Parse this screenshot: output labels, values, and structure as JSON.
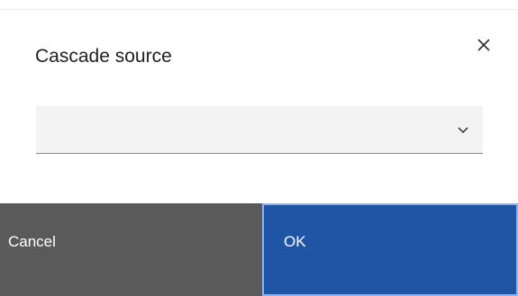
{
  "dialog": {
    "title": "Cascade source",
    "close_icon": "close-icon"
  },
  "select": {
    "value": "",
    "chevron_icon": "chevron-down-icon"
  },
  "footer": {
    "cancel_label": "Cancel",
    "ok_label": "OK"
  },
  "colors": {
    "cancel_bg": "#5a5a5a",
    "ok_bg": "#1e55a5",
    "ok_focus_border": "#8cb2ef",
    "select_bg": "#f3f3f3"
  }
}
